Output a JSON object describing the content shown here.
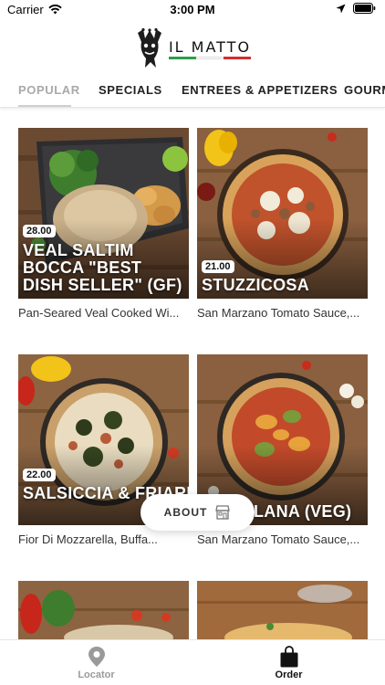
{
  "status_bar": {
    "carrier": "Carrier",
    "time": "3:00 PM"
  },
  "header": {
    "logo_text": "IL MATTO",
    "flag_colors": [
      "#2e9d4a",
      "#ffffff",
      "#d32f2f"
    ]
  },
  "tabs": [
    {
      "label": "POPULAR",
      "active": true
    },
    {
      "label": "SPECIALS",
      "active": false
    },
    {
      "label": "ENTREES & APPETIZERS",
      "active": false
    },
    {
      "label": "GOURM",
      "active": false
    }
  ],
  "menu_items": [
    {
      "price": "28.00",
      "name": "VEAL SALTIM BOCCA \"BEST DISH SELLER\" (GF)",
      "description": "Pan-Seared Veal Cooked Wi..."
    },
    {
      "price": "21.00",
      "name": "STUZZICOSA",
      "description": "San Marzano Tomato Sauce,..."
    },
    {
      "price": "22.00",
      "name": "SALSICCIA & FRIARIELLI (N",
      "description": "Fior Di Mozzarella, Buffa..."
    },
    {
      "price": "",
      "name": "LANA (VEG)",
      "description": "San Marzano Tomato Sauce,..."
    }
  ],
  "about_button": {
    "label": "ABOUT",
    "icon": "storefront-icon"
  },
  "bottom_nav": [
    {
      "label": "Locator",
      "icon": "map-pin-icon",
      "color": "#9a9a9a"
    },
    {
      "label": "Order",
      "icon": "shopping-bag-icon",
      "color": "#111111"
    }
  ],
  "colors": {
    "accent": "#a9a9a9",
    "text": "#222222"
  }
}
